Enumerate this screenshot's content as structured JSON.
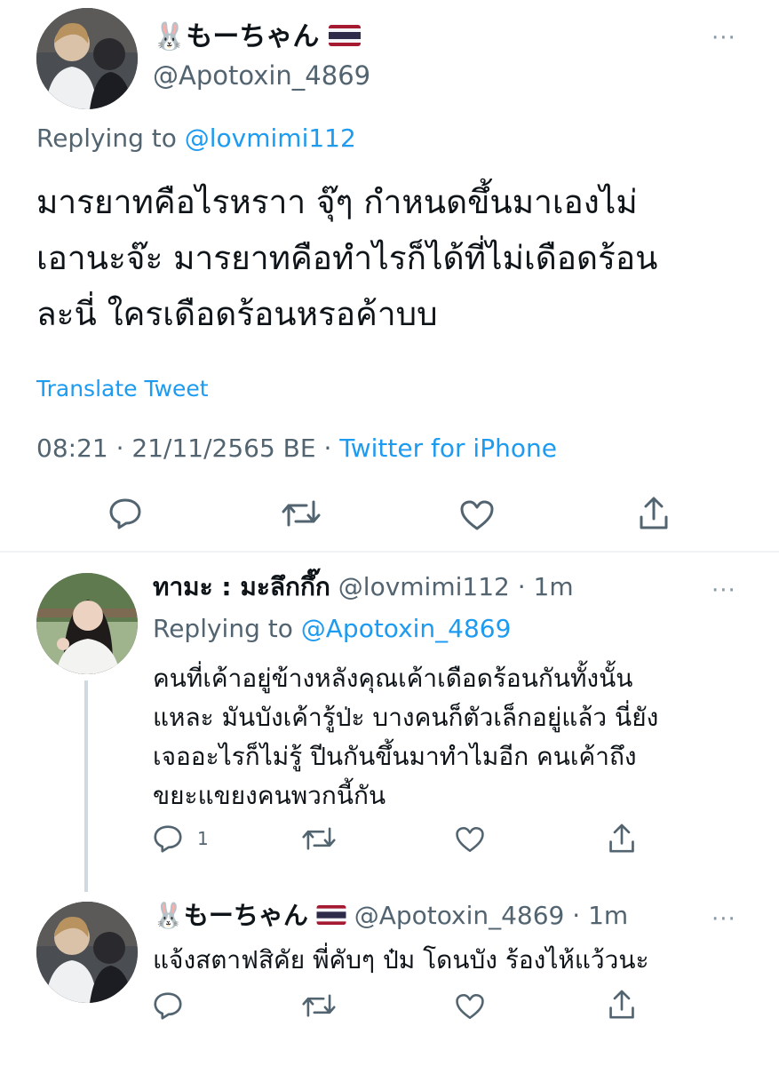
{
  "main_tweet": {
    "emoji_prefix": "🐰",
    "display_name": "もーちゃん",
    "flag_label": "Thailand flag",
    "handle": "@Apotoxin_4869",
    "more": "···",
    "replying_prefix": "Replying to",
    "replying_handle": "@lovmimi112",
    "text_lines": [
      "มารยาทคือไรหราา จุ๊ๆ กำหนดขึ้นมาเองไม่",
      "เอานะจ๊ะ มารยาทคือทำไรก็ได้ที่ไม่เดือดร้อน",
      "ละนี่  ใครเดือดร้อนหรอค้าบบ"
    ],
    "translate": "Translate Tweet",
    "time": "08:21 · 21/11/2565 BE · ",
    "client": "Twitter for iPhone"
  },
  "reply1": {
    "display_name": "ทามะ : มะลึกกึ๊ก",
    "handle": "@lovmimi112",
    "time": "· 1m",
    "more": "···",
    "replying_prefix": "Replying to",
    "replying_handle": "@Apotoxin_4869",
    "text_lines": [
      "คนที่เค้าอยู่ข้างหลังคุณเค้าเดือดร้อนกันทั้งนั้น",
      "แหละ มันบังเค้ารู้ป่ะ บางคนก็ตัวเล็กอยู่แล้ว นี่ยัง",
      "เจออะไรก็ไม่รู้ ปีนกันขึ้นมาทำไมอีก คนเค้าถึง",
      "ขยะแขยงคนพวกนี้กัน"
    ],
    "reply_count": "1"
  },
  "reply2": {
    "emoji_prefix": "🐰",
    "display_name": "もーちゃん",
    "handle": "@Apotoxin_4869",
    "time": "· 1m",
    "more": "···",
    "text": "แจ้งสตาฟสิคัย พี่คับๆ ป๋ม โดนบัง ร้องไห้แว้วนะ"
  },
  "colors": {
    "link": "#1d9bf0",
    "secondary": "#536471",
    "divider": "#eff3f4"
  },
  "icons": [
    "reply-icon",
    "retweet-icon",
    "like-icon",
    "share-icon",
    "more-icon"
  ]
}
